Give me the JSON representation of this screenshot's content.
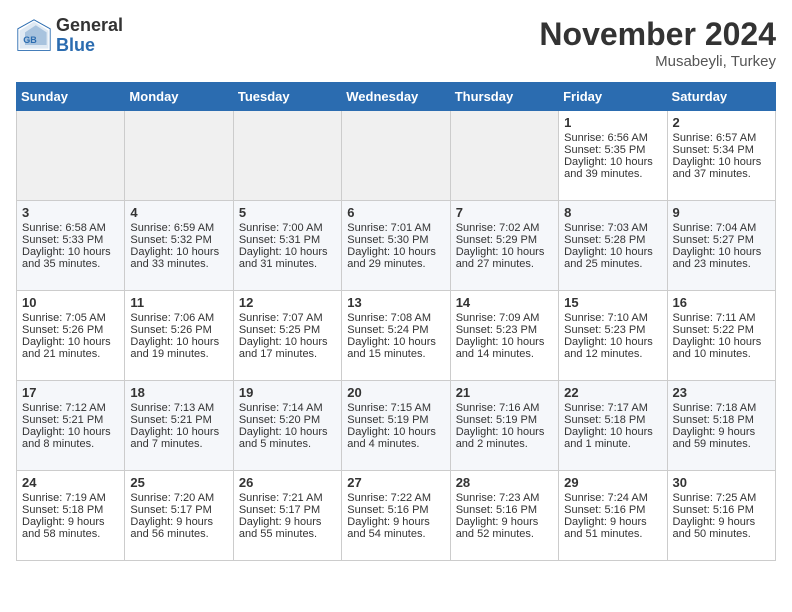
{
  "header": {
    "logo_general": "General",
    "logo_blue": "Blue",
    "month_year": "November 2024",
    "location": "Musabeyli, Turkey"
  },
  "days_of_week": [
    "Sunday",
    "Monday",
    "Tuesday",
    "Wednesday",
    "Thursday",
    "Friday",
    "Saturday"
  ],
  "weeks": [
    [
      {
        "day": "",
        "empty": true
      },
      {
        "day": "",
        "empty": true
      },
      {
        "day": "",
        "empty": true
      },
      {
        "day": "",
        "empty": true
      },
      {
        "day": "",
        "empty": true
      },
      {
        "day": "1",
        "sunrise": "Sunrise: 6:56 AM",
        "sunset": "Sunset: 5:35 PM",
        "daylight": "Daylight: 10 hours and 39 minutes."
      },
      {
        "day": "2",
        "sunrise": "Sunrise: 6:57 AM",
        "sunset": "Sunset: 5:34 PM",
        "daylight": "Daylight: 10 hours and 37 minutes."
      }
    ],
    [
      {
        "day": "3",
        "sunrise": "Sunrise: 6:58 AM",
        "sunset": "Sunset: 5:33 PM",
        "daylight": "Daylight: 10 hours and 35 minutes."
      },
      {
        "day": "4",
        "sunrise": "Sunrise: 6:59 AM",
        "sunset": "Sunset: 5:32 PM",
        "daylight": "Daylight: 10 hours and 33 minutes."
      },
      {
        "day": "5",
        "sunrise": "Sunrise: 7:00 AM",
        "sunset": "Sunset: 5:31 PM",
        "daylight": "Daylight: 10 hours and 31 minutes."
      },
      {
        "day": "6",
        "sunrise": "Sunrise: 7:01 AM",
        "sunset": "Sunset: 5:30 PM",
        "daylight": "Daylight: 10 hours and 29 minutes."
      },
      {
        "day": "7",
        "sunrise": "Sunrise: 7:02 AM",
        "sunset": "Sunset: 5:29 PM",
        "daylight": "Daylight: 10 hours and 27 minutes."
      },
      {
        "day": "8",
        "sunrise": "Sunrise: 7:03 AM",
        "sunset": "Sunset: 5:28 PM",
        "daylight": "Daylight: 10 hours and 25 minutes."
      },
      {
        "day": "9",
        "sunrise": "Sunrise: 7:04 AM",
        "sunset": "Sunset: 5:27 PM",
        "daylight": "Daylight: 10 hours and 23 minutes."
      }
    ],
    [
      {
        "day": "10",
        "sunrise": "Sunrise: 7:05 AM",
        "sunset": "Sunset: 5:26 PM",
        "daylight": "Daylight: 10 hours and 21 minutes."
      },
      {
        "day": "11",
        "sunrise": "Sunrise: 7:06 AM",
        "sunset": "Sunset: 5:26 PM",
        "daylight": "Daylight: 10 hours and 19 minutes."
      },
      {
        "day": "12",
        "sunrise": "Sunrise: 7:07 AM",
        "sunset": "Sunset: 5:25 PM",
        "daylight": "Daylight: 10 hours and 17 minutes."
      },
      {
        "day": "13",
        "sunrise": "Sunrise: 7:08 AM",
        "sunset": "Sunset: 5:24 PM",
        "daylight": "Daylight: 10 hours and 15 minutes."
      },
      {
        "day": "14",
        "sunrise": "Sunrise: 7:09 AM",
        "sunset": "Sunset: 5:23 PM",
        "daylight": "Daylight: 10 hours and 14 minutes."
      },
      {
        "day": "15",
        "sunrise": "Sunrise: 7:10 AM",
        "sunset": "Sunset: 5:23 PM",
        "daylight": "Daylight: 10 hours and 12 minutes."
      },
      {
        "day": "16",
        "sunrise": "Sunrise: 7:11 AM",
        "sunset": "Sunset: 5:22 PM",
        "daylight": "Daylight: 10 hours and 10 minutes."
      }
    ],
    [
      {
        "day": "17",
        "sunrise": "Sunrise: 7:12 AM",
        "sunset": "Sunset: 5:21 PM",
        "daylight": "Daylight: 10 hours and 8 minutes."
      },
      {
        "day": "18",
        "sunrise": "Sunrise: 7:13 AM",
        "sunset": "Sunset: 5:21 PM",
        "daylight": "Daylight: 10 hours and 7 minutes."
      },
      {
        "day": "19",
        "sunrise": "Sunrise: 7:14 AM",
        "sunset": "Sunset: 5:20 PM",
        "daylight": "Daylight: 10 hours and 5 minutes."
      },
      {
        "day": "20",
        "sunrise": "Sunrise: 7:15 AM",
        "sunset": "Sunset: 5:19 PM",
        "daylight": "Daylight: 10 hours and 4 minutes."
      },
      {
        "day": "21",
        "sunrise": "Sunrise: 7:16 AM",
        "sunset": "Sunset: 5:19 PM",
        "daylight": "Daylight: 10 hours and 2 minutes."
      },
      {
        "day": "22",
        "sunrise": "Sunrise: 7:17 AM",
        "sunset": "Sunset: 5:18 PM",
        "daylight": "Daylight: 10 hours and 1 minute."
      },
      {
        "day": "23",
        "sunrise": "Sunrise: 7:18 AM",
        "sunset": "Sunset: 5:18 PM",
        "daylight": "Daylight: 9 hours and 59 minutes."
      }
    ],
    [
      {
        "day": "24",
        "sunrise": "Sunrise: 7:19 AM",
        "sunset": "Sunset: 5:18 PM",
        "daylight": "Daylight: 9 hours and 58 minutes."
      },
      {
        "day": "25",
        "sunrise": "Sunrise: 7:20 AM",
        "sunset": "Sunset: 5:17 PM",
        "daylight": "Daylight: 9 hours and 56 minutes."
      },
      {
        "day": "26",
        "sunrise": "Sunrise: 7:21 AM",
        "sunset": "Sunset: 5:17 PM",
        "daylight": "Daylight: 9 hours and 55 minutes."
      },
      {
        "day": "27",
        "sunrise": "Sunrise: 7:22 AM",
        "sunset": "Sunset: 5:16 PM",
        "daylight": "Daylight: 9 hours and 54 minutes."
      },
      {
        "day": "28",
        "sunrise": "Sunrise: 7:23 AM",
        "sunset": "Sunset: 5:16 PM",
        "daylight": "Daylight: 9 hours and 52 minutes."
      },
      {
        "day": "29",
        "sunrise": "Sunrise: 7:24 AM",
        "sunset": "Sunset: 5:16 PM",
        "daylight": "Daylight: 9 hours and 51 minutes."
      },
      {
        "day": "30",
        "sunrise": "Sunrise: 7:25 AM",
        "sunset": "Sunset: 5:16 PM",
        "daylight": "Daylight: 9 hours and 50 minutes."
      }
    ]
  ]
}
